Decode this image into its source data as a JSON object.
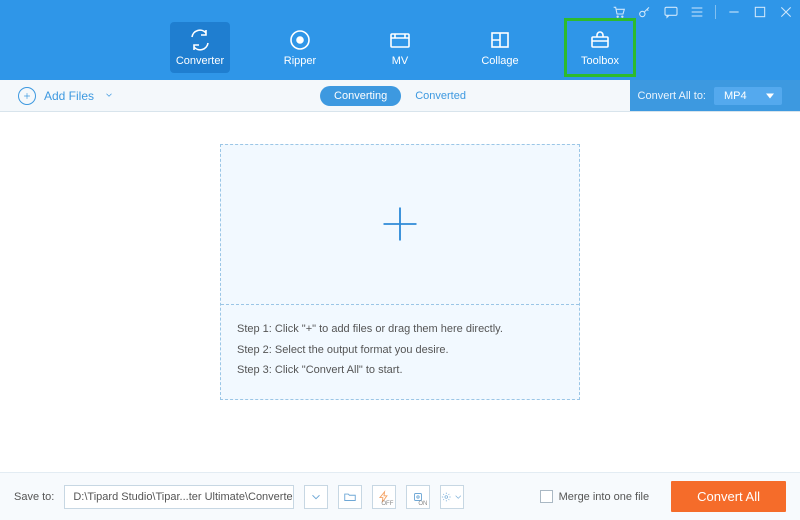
{
  "titlebar": {
    "icons": {
      "cart": "cart-icon",
      "key": "key-icon",
      "chat": "chat-icon",
      "menu": "hamburger-icon",
      "min": "minimize-icon",
      "max": "maximize-icon",
      "close": "close-icon"
    }
  },
  "tabs": [
    {
      "id": "converter",
      "label": "Converter",
      "active": true,
      "highlighted": false
    },
    {
      "id": "ripper",
      "label": "Ripper",
      "active": false,
      "highlighted": false
    },
    {
      "id": "mv",
      "label": "MV",
      "active": false,
      "highlighted": false
    },
    {
      "id": "collage",
      "label": "Collage",
      "active": false,
      "highlighted": false
    },
    {
      "id": "toolbox",
      "label": "Toolbox",
      "active": false,
      "highlighted": true
    }
  ],
  "subbar": {
    "add_files_label": "Add Files",
    "sub_tabs": {
      "converting": "Converting",
      "converted": "Converted"
    },
    "convert_all_label": "Convert All to:",
    "convert_all_value": "MP4"
  },
  "dropzone": {
    "step1": "Step 1: Click \"+\" to add files or drag them here directly.",
    "step2": "Step 2: Select the output format you desire.",
    "step3": "Step 3: Click \"Convert All\" to start."
  },
  "footer": {
    "save_to_label": "Save to:",
    "save_to_path": "D:\\Tipard Studio\\Tipar...ter Ultimate\\Converted",
    "gpu_on": "ON",
    "gpu_off": "OFF",
    "merge_label": "Merge into one file",
    "convert_button": "Convert All"
  },
  "colors": {
    "primary": "#2f96e8",
    "accent": "#f56c2a",
    "highlight": "#2dbb2d"
  }
}
